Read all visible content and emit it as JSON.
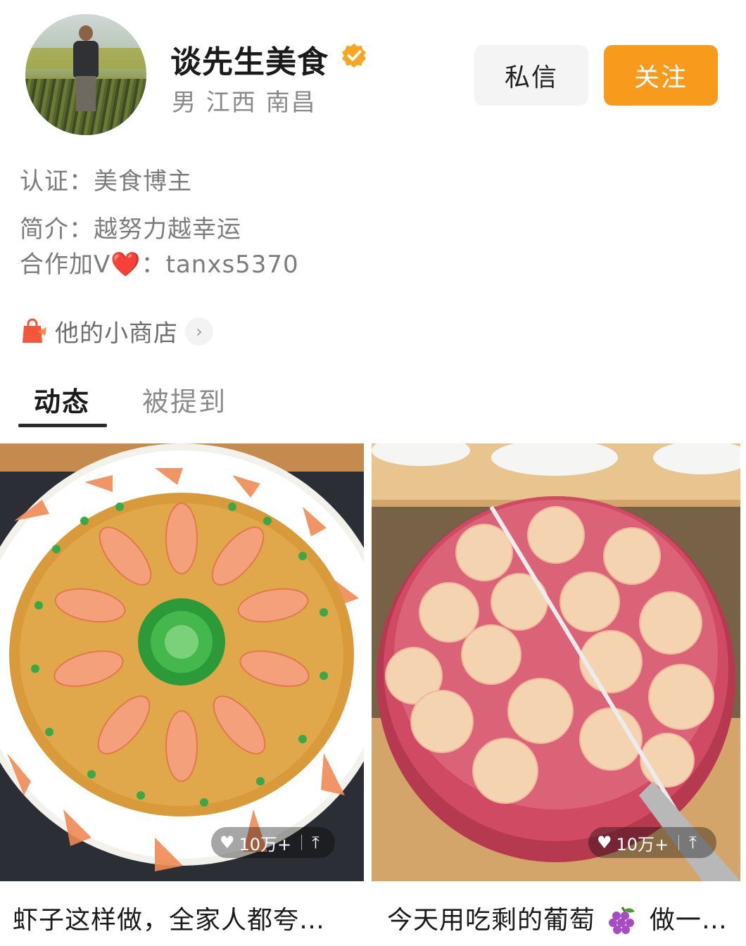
{
  "profile": {
    "name": "谈先生美食",
    "meta": "男 江西 南昌",
    "certification": "认证：美食博主",
    "bio_line1": "简介：越努力越幸运",
    "bio_line2_prefix": "合作加V",
    "bio_line2_heart": "❤️",
    "bio_line2_suffix": "：tanxs5370"
  },
  "actions": {
    "message_label": "私信",
    "follow_label": "关注"
  },
  "shop": {
    "label": "他的小商店"
  },
  "tabs": [
    {
      "label": "动态",
      "active": true
    },
    {
      "label": "被提到",
      "active": false
    }
  ],
  "posts": [
    {
      "likes": "10万+",
      "caption": "虾子这样做，全家人都夸…"
    },
    {
      "likes": "10万+",
      "caption_prefix": "今天用吃剩的葡萄",
      "caption_suffix": "做一…"
    }
  ],
  "colors": {
    "accent": "#f89a1c",
    "verified": "#f5a623"
  },
  "icons": [
    "verified-badge-icon",
    "shopping-bag-icon",
    "chevron-right-icon",
    "heart-icon",
    "share-icon",
    "grape-icon"
  ]
}
